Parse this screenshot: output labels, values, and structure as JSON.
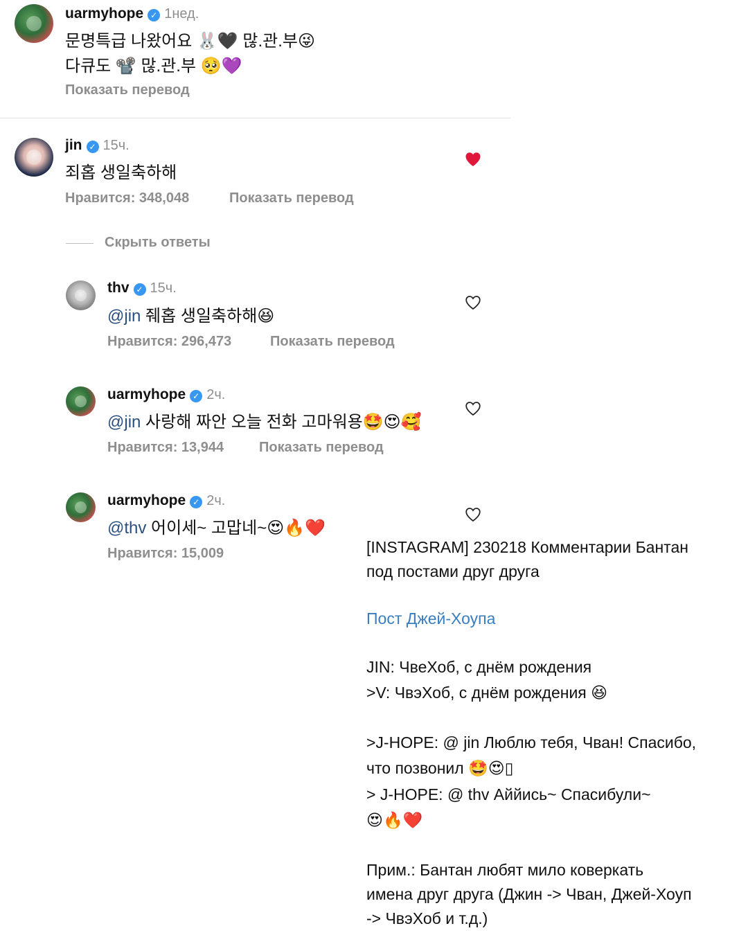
{
  "post_caption": {
    "username": "uarmyhope",
    "time": "1нед.",
    "line1": "문명특급 나왔어요 🐰🖤 많.관.부😜",
    "line2": "다큐도 📽️ 많.관.부 🥺💜",
    "translate_label": "Показать перевод"
  },
  "comment_jin": {
    "username": "jin",
    "time": "15ч.",
    "text": "죄홉 생일축하해",
    "likes": "Нравится: 348,048",
    "translate_label": "Показать перевод",
    "liked": true
  },
  "hide_replies_label": "Скрыть ответы",
  "reply_thv": {
    "username": "thv",
    "time": "15ч.",
    "mention": "@jin",
    "text": " 줴홉 생일축하해😆",
    "likes": "Нравится: 296,473",
    "translate_label": "Показать перевод"
  },
  "reply_hope1": {
    "username": "uarmyhope",
    "time": "2ч.",
    "mention": "@jin",
    "text": " 사랑해 짜안 오늘 전화 고마워용🤩😍🥰",
    "likes": "Нравится: 13,944",
    "translate_label": "Показать перевод"
  },
  "reply_hope2": {
    "username": "uarmyhope",
    "time": "2ч.",
    "mention": "@thv",
    "text": " 어이세~ 고맙네~😍🔥❤️",
    "likes": "Нравится: 15,009"
  },
  "note": {
    "title_line1": "[INSTAGRAM] 230218 Комментарии Бантан",
    "title_line2": "под постами друг друга",
    "link": "Пост Джей-Хоупа",
    "l1": "JIN: ЧвеХоб, с днём рождения",
    "l2": ">V: ЧвэХоб, с днём рождения 😆",
    "l3": ">J-HOPE: @ jin Люблю тебя, Чван! Спасибо,",
    "l4": "что позвонил 🤩😍▯",
    "l5": "> J-HOPE: @ thv Аййись~ Спасибули~",
    "l6": "😍🔥❤️",
    "l7": "Прим.: Бантан любят мило коверкать",
    "l8": "имена друг друга (Джин -> Чван, Джей-Хоуп",
    "l9": "-> ЧвэХоб и т.д.)"
  },
  "colors": {
    "liked_heart": "#e0163b",
    "verified": "#3897f0",
    "note_link": "#3a7ec0"
  }
}
